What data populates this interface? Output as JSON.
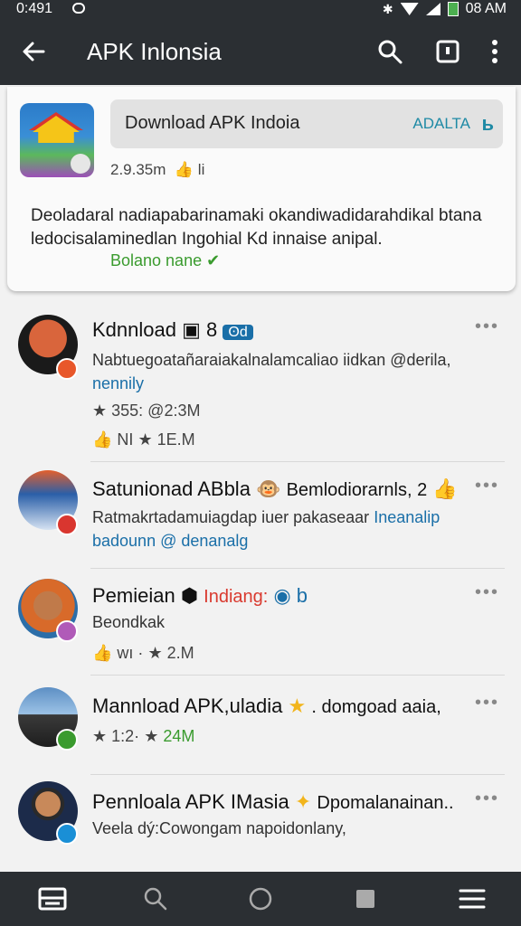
{
  "status_bar": {
    "time": "0:491",
    "clock_right": "08 AM"
  },
  "app_bar": {
    "title": "APK Inlonsia"
  },
  "featured": {
    "download_label": "Download APK Indoia",
    "tag": "ADALTA",
    "meta": "2.9.35m",
    "meta_icon": "thumb-icon",
    "meta_suffix": "li",
    "description": "Deoladaral nadiapabarinamaki okandiwadidarahdikal btana ledocisalaminedlan Ingohial Kd innaise anipal.",
    "link": "Bolano nane"
  },
  "posts": [
    {
      "name": "Kdnnload",
      "name_suffix": "8",
      "chip": "ʘd",
      "text1": "Nabtuegoatañaraiakalnalamcaliao iidkan @derila,",
      "text2": "nennily",
      "stat1": "355: @2:3M",
      "stat2": "NI",
      "stat2b": "1E.M"
    },
    {
      "name": "Satunionad ABbla",
      "extra": "Bemlodiorarnls, 2",
      "text1": "Ratmakrtadamuiagdap iuer pakaseaar",
      "text1_accent": "Ineanalip",
      "text2": "badounn @ denanalg"
    },
    {
      "name": "Pemieian",
      "accent": "Indiang:",
      "suffix": "b",
      "text1": "Beondkak",
      "stat1": "wı ·",
      "stat1b": "2.M"
    },
    {
      "name": "Mannload APK,uladia",
      "extra": ". domgoad aaia,",
      "stat1": "1:2·",
      "stat1b": "24M"
    },
    {
      "name": "Pennloala APK IMasia",
      "extra": "Dpomalanainan..",
      "text1": "Veela dý:Cowongam napoidonlany,"
    }
  ],
  "colors": {
    "bar": "#2b2f33",
    "link_blue": "#1a6fa8",
    "green": "#3a9b2e",
    "red": "#d93a2f"
  }
}
